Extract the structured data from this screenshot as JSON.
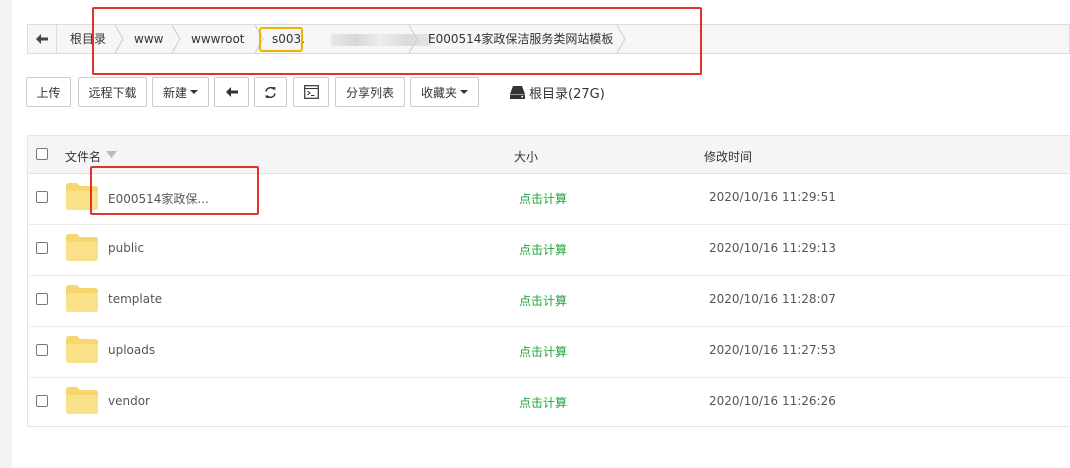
{
  "breadcrumb": {
    "items": [
      "根目录",
      "www",
      "wwwroot",
      "s003.",
      "E000514家政保洁服务类网站模板"
    ]
  },
  "toolbar": {
    "upload": "上传",
    "remote_download": "远程下载",
    "new": "新建",
    "share_list": "分享列表",
    "favorites": "收藏夹",
    "disk_label": "根目录(27G)"
  },
  "table": {
    "headers": {
      "name": "文件名",
      "size": "大小",
      "modified": "修改时间"
    },
    "rows": [
      {
        "name": "E000514家政保...",
        "size": "点击计算",
        "modified": "2020/10/16 11:29:51"
      },
      {
        "name": "public",
        "size": "点击计算",
        "modified": "2020/10/16 11:29:13"
      },
      {
        "name": "template",
        "size": "点击计算",
        "modified": "2020/10/16 11:28:07"
      },
      {
        "name": "uploads",
        "size": "点击计算",
        "modified": "2020/10/16 11:27:53"
      },
      {
        "name": "vendor",
        "size": "点击计算",
        "modified": "2020/10/16 11:26:26"
      }
    ]
  },
  "colors": {
    "accent_green": "#20a53a",
    "annotation_red": "#e4322b",
    "annotation_yellow": "#f0b400",
    "folder_yellow": "#f7d56f"
  }
}
